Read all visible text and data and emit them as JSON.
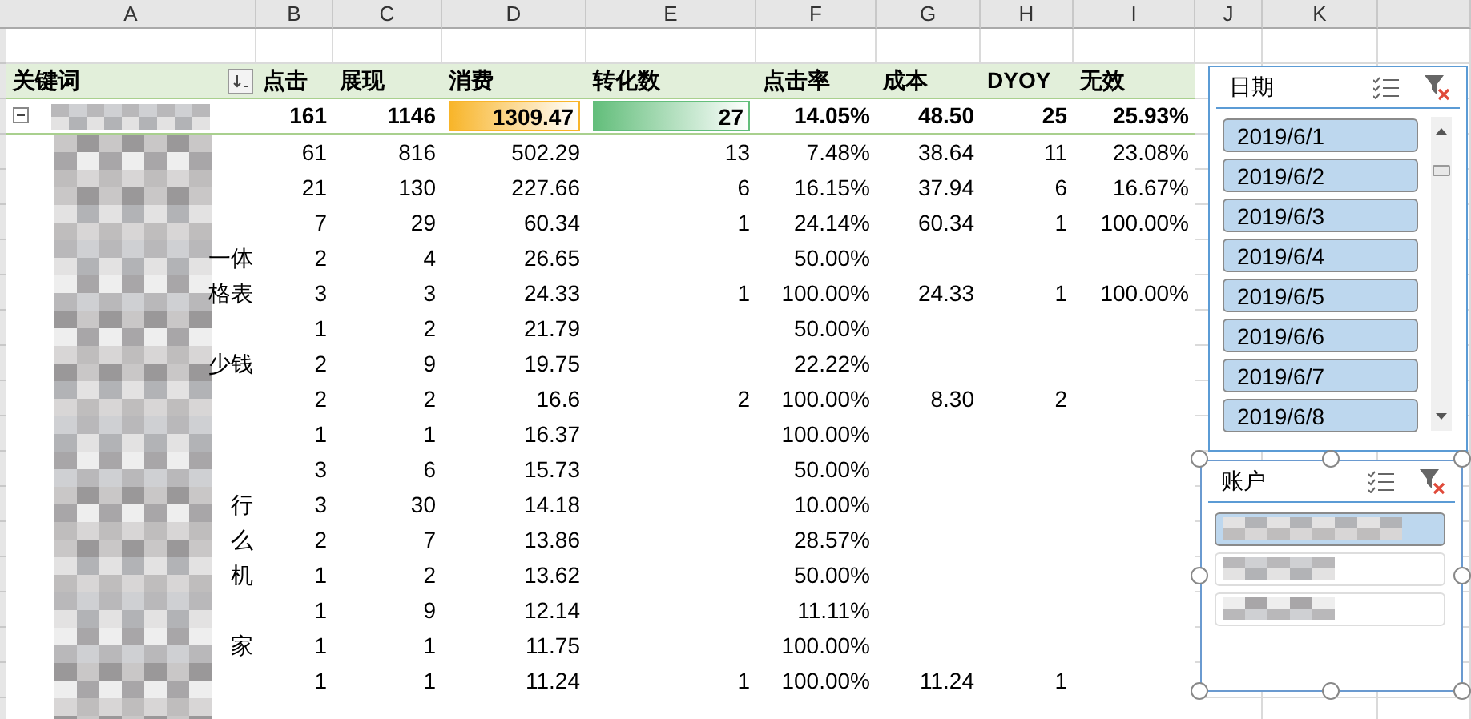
{
  "sheet": {
    "column_headers": [
      "A",
      "B",
      "C",
      "D",
      "E",
      "F",
      "G",
      "H",
      "I",
      "J",
      "K"
    ]
  },
  "pivot": {
    "row_field_sort_button": true,
    "headers": [
      "关键词",
      "点击",
      "展现",
      "消费",
      "转化数",
      "点击率",
      "成本",
      "DYOY",
      "无效"
    ],
    "total": {
      "expanded": true,
      "redacted": true,
      "cells": [
        {
          "text": "161"
        },
        {
          "text": "1146"
        },
        {
          "text": "1309.47",
          "color": "#f8b52a"
        },
        {
          "text": "27",
          "color": "#63be7b"
        },
        {
          "text": "14.05%"
        },
        {
          "text": "48.50"
        },
        {
          "text": "25"
        },
        {
          "text": "25.93%"
        }
      ]
    },
    "rows": [
      {
        "redacted": true,
        "cells": [
          "61",
          "816",
          "502.29",
          "13",
          "7.48%",
          "38.64",
          "11",
          "23.08%"
        ]
      },
      {
        "redacted": true,
        "cells": [
          "21",
          "130",
          "227.66",
          "6",
          "16.15%",
          "37.94",
          "6",
          "16.67%"
        ]
      },
      {
        "redacted": true,
        "cells": [
          "7",
          "29",
          "60.34",
          "1",
          "24.14%",
          "60.34",
          "1",
          "100.00%"
        ]
      },
      {
        "redacted": true,
        "keyword_fragment": "一体",
        "cells": [
          "2",
          "4",
          "26.65",
          null,
          "50.00%",
          null,
          null,
          null
        ]
      },
      {
        "redacted": true,
        "keyword_fragment": "格表",
        "cells": [
          "3",
          "3",
          "24.33",
          "1",
          "100.00%",
          "24.33",
          "1",
          "100.00%"
        ]
      },
      {
        "redacted": true,
        "cells": [
          "1",
          "2",
          "21.79",
          null,
          "50.00%",
          null,
          null,
          null
        ]
      },
      {
        "redacted": true,
        "keyword_fragment": "少钱",
        "cells": [
          "2",
          "9",
          "19.75",
          null,
          "22.22%",
          null,
          null,
          null
        ]
      },
      {
        "redacted": true,
        "cells": [
          "2",
          "2",
          "16.6",
          "2",
          "100.00%",
          "8.30",
          "2",
          null
        ]
      },
      {
        "redacted": true,
        "cells": [
          "1",
          "1",
          "16.37",
          null,
          "100.00%",
          null,
          null,
          null
        ]
      },
      {
        "redacted": true,
        "cells": [
          "3",
          "6",
          "15.73",
          null,
          "50.00%",
          null,
          null,
          null
        ]
      },
      {
        "redacted": true,
        "keyword_fragment": "行",
        "cells": [
          "3",
          "30",
          "14.18",
          null,
          "10.00%",
          null,
          null,
          null
        ]
      },
      {
        "redacted": true,
        "keyword_fragment": "么",
        "cells": [
          "2",
          "7",
          "13.86",
          null,
          "28.57%",
          null,
          null,
          null
        ]
      },
      {
        "redacted": true,
        "keyword_fragment": "机",
        "cells": [
          "1",
          "2",
          "13.62",
          null,
          "50.00%",
          null,
          null,
          null
        ]
      },
      {
        "redacted": true,
        "cells": [
          "1",
          "9",
          "12.14",
          null,
          "11.11%",
          null,
          null,
          null
        ]
      },
      {
        "redacted": true,
        "keyword_fragment": "家",
        "cells": [
          "1",
          "1",
          "11.75",
          null,
          "100.00%",
          null,
          null,
          null
        ]
      },
      {
        "redacted": true,
        "cells": [
          "1",
          "1",
          "11.24",
          "1",
          "100.00%",
          "11.24",
          "1",
          null
        ]
      },
      {
        "redacted": true,
        "cells": [
          null,
          null,
          null,
          null,
          null,
          null,
          null,
          null
        ]
      }
    ]
  },
  "slicers": [
    {
      "title": "日期",
      "selected": false,
      "scrollable": true,
      "items": [
        {
          "label": "2019/6/1",
          "selected": true
        },
        {
          "label": "2019/6/2",
          "selected": true
        },
        {
          "label": "2019/6/3",
          "selected": true
        },
        {
          "label": "2019/6/4",
          "selected": true
        },
        {
          "label": "2019/6/5",
          "selected": true
        },
        {
          "label": "2019/6/6",
          "selected": true
        },
        {
          "label": "2019/6/7",
          "selected": true
        },
        {
          "label": "2019/6/8",
          "selected": true
        }
      ]
    },
    {
      "title": "账户",
      "selected": true,
      "scrollable": false,
      "items": [
        {
          "redacted": true,
          "selected": true
        },
        {
          "redacted": true,
          "selected": false
        },
        {
          "redacted": true,
          "selected": false
        }
      ]
    }
  ]
}
